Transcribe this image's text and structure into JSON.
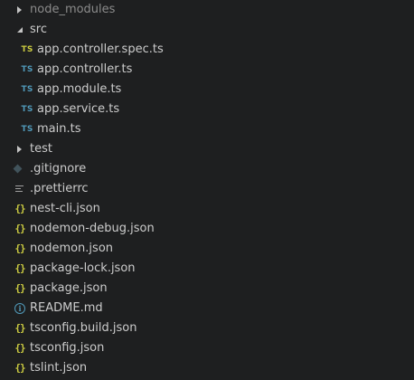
{
  "explorer": {
    "items": [
      {
        "label": "node_modules",
        "kind": "folder",
        "state": "collapsed",
        "icon": "chevron-right-icon"
      },
      {
        "label": "src",
        "kind": "folder",
        "state": "expanded",
        "icon": "chevron-down-icon"
      },
      {
        "label": "app.controller.spec.ts",
        "kind": "file",
        "icon": "typescript-icon",
        "icon_text": "TS",
        "icon_color": "#cbcb41"
      },
      {
        "label": "app.controller.ts",
        "kind": "file",
        "icon": "typescript-icon",
        "icon_text": "TS",
        "icon_color": "#519aba"
      },
      {
        "label": "app.module.ts",
        "kind": "file",
        "icon": "typescript-icon",
        "icon_text": "TS",
        "icon_color": "#519aba"
      },
      {
        "label": "app.service.ts",
        "kind": "file",
        "icon": "typescript-icon",
        "icon_text": "TS",
        "icon_color": "#519aba"
      },
      {
        "label": "main.ts",
        "kind": "file",
        "icon": "typescript-icon",
        "icon_text": "TS",
        "icon_color": "#519aba"
      },
      {
        "label": "test",
        "kind": "folder",
        "state": "collapsed",
        "icon": "chevron-right-icon"
      },
      {
        "label": ".gitignore",
        "kind": "file",
        "icon": "git-icon"
      },
      {
        "label": ".prettierrc",
        "kind": "file",
        "icon": "config-lines-icon"
      },
      {
        "label": "nest-cli.json",
        "kind": "file",
        "icon": "json-icon",
        "icon_text": "{}"
      },
      {
        "label": "nodemon-debug.json",
        "kind": "file",
        "icon": "json-icon",
        "icon_text": "{}"
      },
      {
        "label": "nodemon.json",
        "kind": "file",
        "icon": "json-icon",
        "icon_text": "{}"
      },
      {
        "label": "package-lock.json",
        "kind": "file",
        "icon": "json-icon",
        "icon_text": "{}"
      },
      {
        "label": "package.json",
        "kind": "file",
        "icon": "json-icon",
        "icon_text": "{}"
      },
      {
        "label": "README.md",
        "kind": "file",
        "icon": "info-icon",
        "icon_text": "i"
      },
      {
        "label": "tsconfig.build.json",
        "kind": "file",
        "icon": "json-icon",
        "icon_text": "{}"
      },
      {
        "label": "tsconfig.json",
        "kind": "file",
        "icon": "json-icon",
        "icon_text": "{}"
      },
      {
        "label": "tslint.json",
        "kind": "file",
        "icon": "json-icon",
        "icon_text": "{}"
      }
    ]
  },
  "colors": {
    "background": "#1e1f20",
    "text": "#cccccc",
    "dim_text": "#8b8b8b",
    "ts_blue": "#519aba",
    "ts_yellow": "#cbcb41",
    "json_yellow": "#cbcb41",
    "info_blue": "#519aba"
  }
}
